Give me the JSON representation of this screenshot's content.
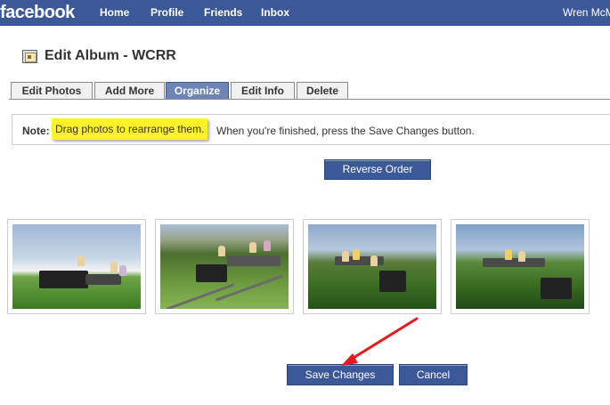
{
  "app": {
    "logo": "facebook",
    "nav": [
      "Home",
      "Profile",
      "Friends",
      "Inbox"
    ],
    "user_name": "Wren McM"
  },
  "page": {
    "title": "Edit Album - WCRR"
  },
  "tabs": [
    {
      "label": "Edit Photos",
      "active": false
    },
    {
      "label": "Add More",
      "active": false
    },
    {
      "label": "Organize",
      "active": true
    },
    {
      "label": "Edit Info",
      "active": false
    },
    {
      "label": "Delete",
      "active": false
    }
  ],
  "note": {
    "label": "Note:",
    "highlight": "Drag photos to rearrange them.",
    "rest": "When you're finished, press the Save Changes button."
  },
  "buttons": {
    "reverse": "Reverse Order",
    "save": "Save Changes",
    "cancel": "Cancel"
  },
  "colors": {
    "brand": "#3b5998",
    "tab_active": "#6d84b4",
    "highlight": "#fff22a",
    "annotation_arrow": "#e8171c"
  }
}
